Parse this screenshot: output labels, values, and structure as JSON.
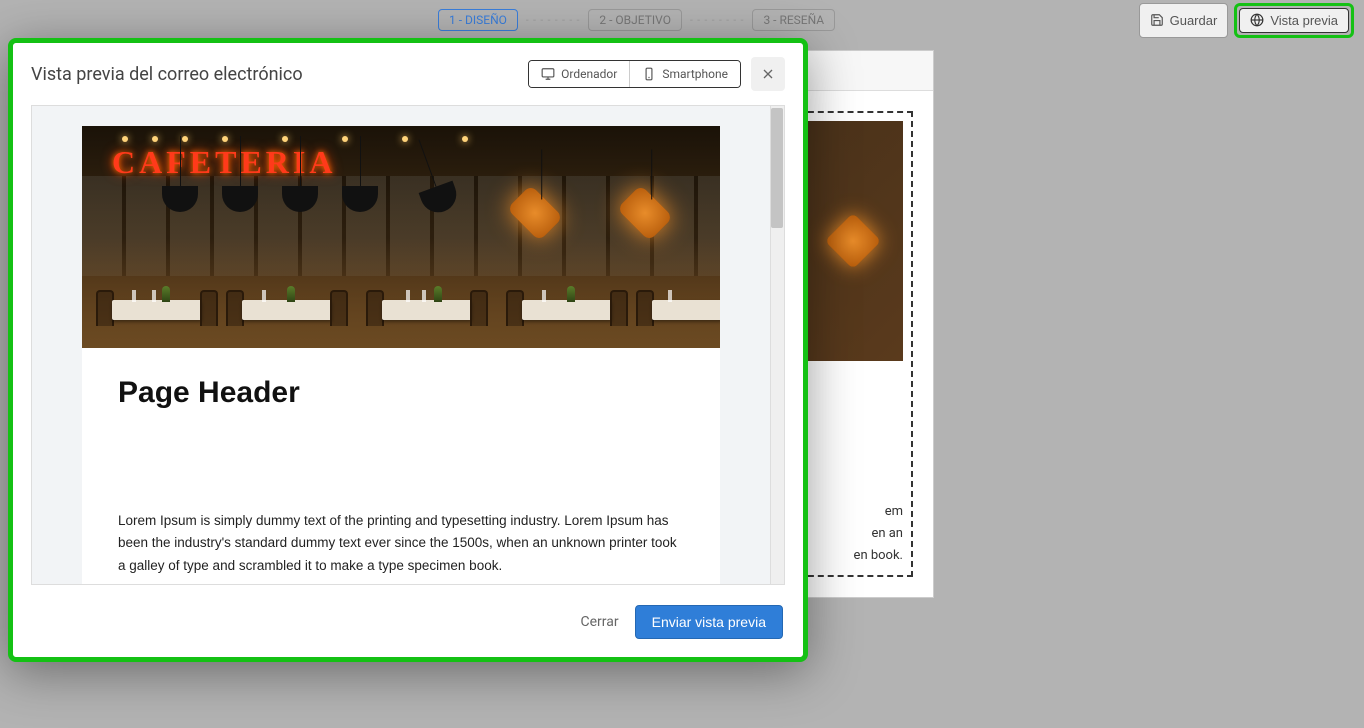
{
  "steps": {
    "s1": "1 - DISEÑO",
    "s2": "2 - OBJETIVO",
    "s3": "3 - RESEÑA"
  },
  "top_buttons": {
    "save": "Guardar",
    "preview": "Vista previa"
  },
  "modal": {
    "title": "Vista previa del correo electrónico",
    "device_desktop": "Ordenador",
    "device_mobile": "Smartphone",
    "close_label": "Cerrar",
    "send_label": "Enviar vista previa"
  },
  "email": {
    "sign_text": "CAFETERIA",
    "header": "Page Header",
    "body": "Lorem Ipsum is simply dummy text of the printing and typesetting industry. Lorem Ipsum has been the industry's standard dummy text ever since the 1500s, when an unknown printer took a galley of type and scrambled it to make a type specimen book."
  },
  "bg_editor": {
    "text_tail1": "em",
    "text_tail2": "en an",
    "text_tail3": "en book."
  }
}
